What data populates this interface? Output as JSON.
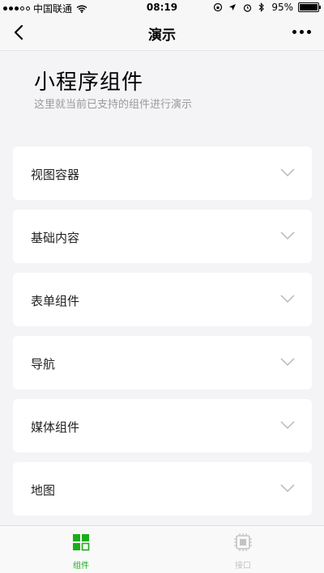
{
  "status_bar": {
    "carrier": "中国联通",
    "time": "08:19",
    "battery_percent": "95%"
  },
  "nav": {
    "title": "演示"
  },
  "header": {
    "title": "小程序组件",
    "description": "这里就当前已支持的组件进行演示"
  },
  "categories": [
    {
      "label": "视图容器"
    },
    {
      "label": "基础内容"
    },
    {
      "label": "表单组件"
    },
    {
      "label": "导航"
    },
    {
      "label": "媒体组件"
    },
    {
      "label": "地图"
    }
  ],
  "tabbar": {
    "tabs": [
      {
        "label": "组件",
        "icon": "components-grid-icon",
        "active": true
      },
      {
        "label": "接口",
        "icon": "api-chip-icon",
        "active": false
      }
    ]
  },
  "colors": {
    "accent_green": "#1aad19",
    "inactive_gray": "#c3c3c3"
  }
}
